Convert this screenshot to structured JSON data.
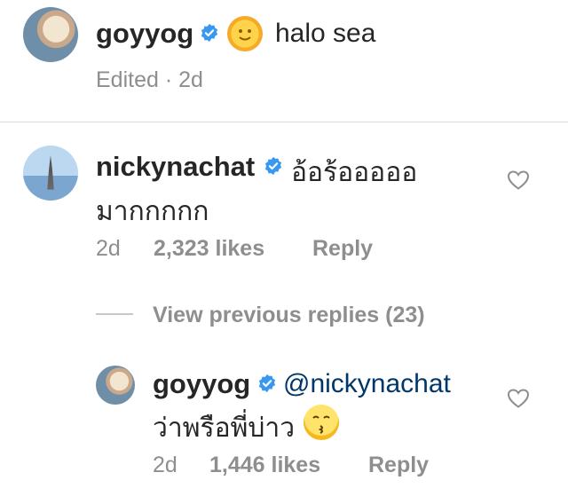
{
  "caption": {
    "username": "goyyog",
    "text": "halo sea",
    "emoji": "sun-with-face-emoji",
    "meta": "Edited · 2d"
  },
  "comment": {
    "username": "nickynachat",
    "text_line1": "อ้อร้อออออ",
    "text_line2": "มากกกกก",
    "time": "2d",
    "likes": "2,323 likes",
    "reply_label": "Reply"
  },
  "view_replies": "View previous replies (23)",
  "reply": {
    "username": "goyyog",
    "mention": "@nickynachat",
    "text": "ว่าพรือพี่บ่าว",
    "emoji": "kissing-face-emoji",
    "time": "2d",
    "likes": "1,446 likes",
    "reply_label": "Reply"
  },
  "colors": {
    "verified_blue": "#3897f0",
    "text": "#262626",
    "secondary": "#8e8e8e",
    "mention": "#00376b"
  }
}
